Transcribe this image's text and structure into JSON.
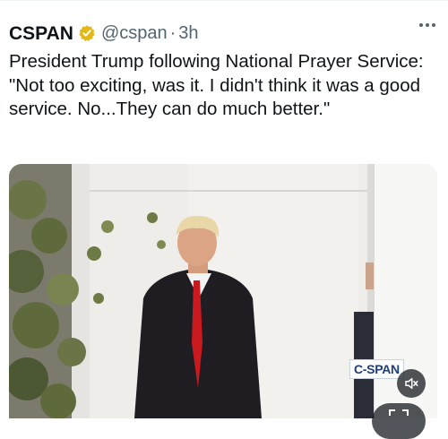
{
  "tweet": {
    "author_name": "CSPAN",
    "handle": "@cspan",
    "separator": "·",
    "time": "3h",
    "text": "President Trump following National Prayer Service: \"Not too exciting, was it. I didn't think it was a good service. No...They can do much better.\""
  },
  "media": {
    "badge_text": "C-SPAN"
  },
  "icons": {
    "verified": "verified-badge-icon",
    "more": "more-options-icon",
    "mute": "speaker-muted-icon",
    "expand": "fullscreen-icon"
  },
  "colors": {
    "verified_gold": "#e2b719",
    "secondary_text": "#536471",
    "badge_blue": "#1d3d7b",
    "tie_red": "#c81a1f"
  }
}
